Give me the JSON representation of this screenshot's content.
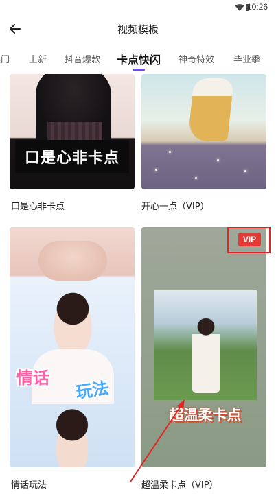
{
  "status_bar": {
    "time": "10:26"
  },
  "header": {
    "title": "视频模板"
  },
  "tabs": [
    {
      "label": "热门",
      "active": false
    },
    {
      "label": "上新",
      "active": false
    },
    {
      "label": "抖音爆款",
      "active": false
    },
    {
      "label": "卡点快闪",
      "active": true
    },
    {
      "label": "神奇特效",
      "active": false
    },
    {
      "label": "毕业季",
      "active": false
    }
  ],
  "templates": [
    {
      "title": "口是心非卡点",
      "overlay_text": "口是心非卡点",
      "vip": false
    },
    {
      "title": "开心一点（VIP）",
      "vip": true
    },
    {
      "title": "情话玩法",
      "overlay_words": [
        "情话",
        "玩法"
      ],
      "vip": false
    },
    {
      "title": "超温柔卡点（VIP）",
      "overlay_text": "超温柔卡点",
      "vip": true,
      "badge": "VIP"
    }
  ],
  "colors": {
    "accent": "#6c4de6",
    "vip_badge": "#e53935",
    "annotation": "#e02424"
  }
}
